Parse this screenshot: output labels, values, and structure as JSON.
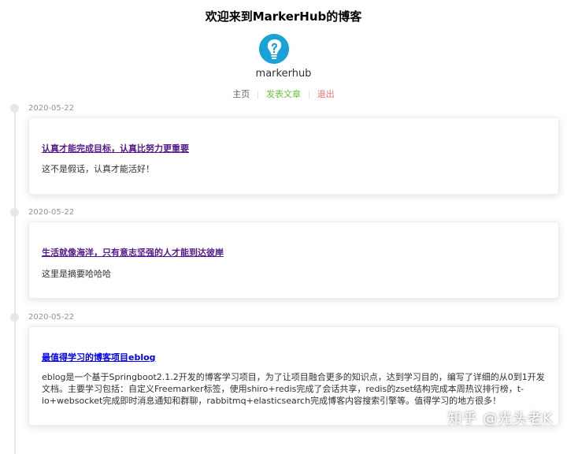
{
  "header": {
    "title": "欢迎来到MarkerHub的博客",
    "username": "markerhub",
    "accent_color": "#1aa1d8"
  },
  "nav": {
    "home": "主页",
    "publish": "发表文章",
    "logout": "退出",
    "separator": "|"
  },
  "posts": [
    {
      "date": "2020-05-22",
      "title": "认真才能完成目标，认真比努力更重要",
      "description": "这不是假话，认真才能活好！"
    },
    {
      "date": "2020-05-22",
      "title": "生活就像海洋，只有意志坚强的人才能到达彼岸",
      "description": "这里是摘要哈哈哈"
    },
    {
      "date": "2020-05-22",
      "title": "最值得学习的博客项目eblog",
      "description": "eblog是一个基于Springboot2.1.2开发的博客学习项目，为了让项目融合更多的知识点，达到学习目的，编写了详细的从0到1开发文档。主要学习包括：自定义Freemarker标签，使用shiro+redis完成了会话共享，redis的zset结构完成本周热议排行榜，t-io+websocket完成即时消息通知和群聊，rabbitmq+elasticsearch完成博客内容搜索引擎等。值得学习的地方很多！"
    }
  ],
  "watermark": "知乎 @光头老K"
}
